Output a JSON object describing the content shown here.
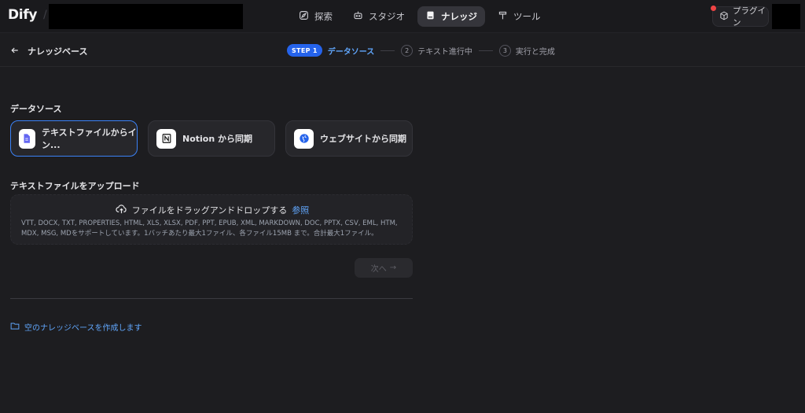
{
  "app": {
    "logo": "Dify"
  },
  "nav": {
    "items": [
      {
        "label": "探索",
        "icon": "compass-icon"
      },
      {
        "label": "スタジオ",
        "icon": "robot-icon"
      },
      {
        "label": "ナレッジ",
        "icon": "book-icon",
        "active": true
      },
      {
        "label": "ツール",
        "icon": "hammer-icon"
      }
    ]
  },
  "header": {
    "plugin_label": "プラグイン"
  },
  "subheader": {
    "back_label": "ナレッジベース",
    "steps": {
      "step1_badge": "STEP 1",
      "step1_label": "データソース",
      "step2_num": "2",
      "step2_label": "テキスト進行中",
      "step3_num": "3",
      "step3_label": "実行と完成"
    }
  },
  "datasource": {
    "title": "データソース",
    "cards": [
      {
        "label": "テキストファイルからイン...",
        "icon": "file-icon"
      },
      {
        "label": "Notion から同期",
        "icon": "notion-icon"
      },
      {
        "label": "ウェブサイトから同期",
        "icon": "globe-icon"
      }
    ]
  },
  "upload": {
    "title": "テキストファイルをアップロード",
    "drop_text": "ファイルをドラッグアンドドロップする",
    "browse": "参照",
    "desc_line1": "VTT, DOCX, TXT, PROPERTIES, HTML, XLS, XLSX, PDF, PPT, EPUB, XML, MARKDOWN, DOC, PPTX, CSV, EML, HTM,",
    "desc_line2": "MDX, MSG, MDをサポートしています。1バッチあたり最大1ファイル、各ファイル15MB まで。合計最大1ファイル。"
  },
  "actions": {
    "next_label": "次へ",
    "next_arrow": "→"
  },
  "empty_kb": {
    "label": "空のナレッジベースを作成します"
  },
  "colors": {
    "accent": "#3b82f6",
    "link": "#60a5fa",
    "background": "#1d1d20"
  }
}
